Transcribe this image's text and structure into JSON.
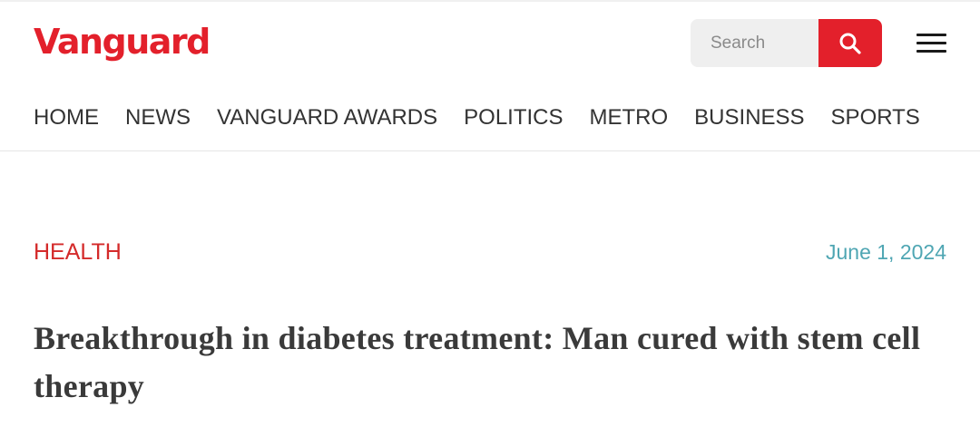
{
  "header": {
    "logo_text": "Vanguard",
    "brand_color": "#e3202b",
    "search": {
      "placeholder": "Search",
      "button_icon": "search-icon"
    },
    "menu_icon": "hamburger-menu-icon"
  },
  "nav": {
    "items": [
      {
        "label": "HOME"
      },
      {
        "label": "NEWS"
      },
      {
        "label": "VANGUARD AWARDS"
      },
      {
        "label": "POLITICS"
      },
      {
        "label": "METRO"
      },
      {
        "label": "BUSINESS"
      },
      {
        "label": "SPORTS"
      }
    ]
  },
  "article": {
    "category": "HEALTH",
    "category_color": "#d42a2a",
    "date": "June 1, 2024",
    "date_color": "#4fa6b3",
    "headline": "Breakthrough in diabetes treatment: Man cured with stem cell therapy"
  }
}
